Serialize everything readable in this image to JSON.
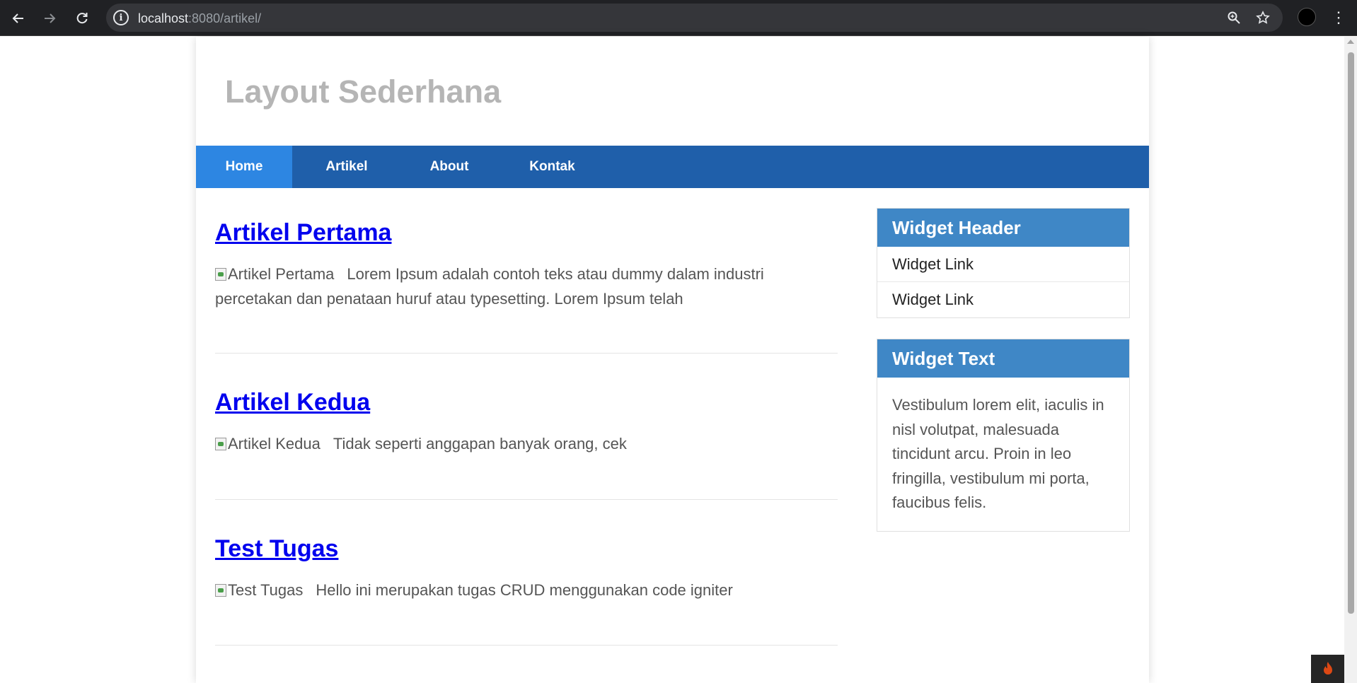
{
  "browser": {
    "url_host": "localhost",
    "url_rest": ":8080/artikel/",
    "back_icon": "arrow-left-icon",
    "forward_icon": "arrow-right-icon",
    "reload_icon": "reload-icon"
  },
  "site": {
    "title": "Layout Sederhana"
  },
  "nav": {
    "items": [
      {
        "label": "Home",
        "active": true
      },
      {
        "label": "Artikel",
        "active": false
      },
      {
        "label": "About",
        "active": false
      },
      {
        "label": "Kontak",
        "active": false
      }
    ]
  },
  "articles": [
    {
      "title": "Artikel Pertama",
      "img_alt": "Artikel Pertama",
      "text": "Lorem Ipsum adalah contoh teks atau dummy dalam industri percetakan dan penataan huruf atau typesetting. Lorem Ipsum telah"
    },
    {
      "title": "Artikel Kedua",
      "img_alt": "Artikel Kedua",
      "text": "Tidak seperti anggapan banyak orang, cek"
    },
    {
      "title": "Test Tugas",
      "img_alt": "Test Tugas",
      "text": "Hello ini merupakan tugas CRUD menggunakan code igniter"
    }
  ],
  "sidebar": {
    "widget1": {
      "header": "Widget Header",
      "links": [
        "Widget Link",
        "Widget Link"
      ]
    },
    "widget2": {
      "header": "Widget Text",
      "text": "Vestibulum lorem elit, iaculis in nisl volutpat, malesuada tincidunt arcu. Proin in leo fringilla, vestibulum mi porta, faucibus felis."
    }
  },
  "colors": {
    "nav_bg": "#1f5faa",
    "nav_active": "#2d86e2",
    "widget_header": "#3f87c6",
    "link": "#0000ee"
  }
}
